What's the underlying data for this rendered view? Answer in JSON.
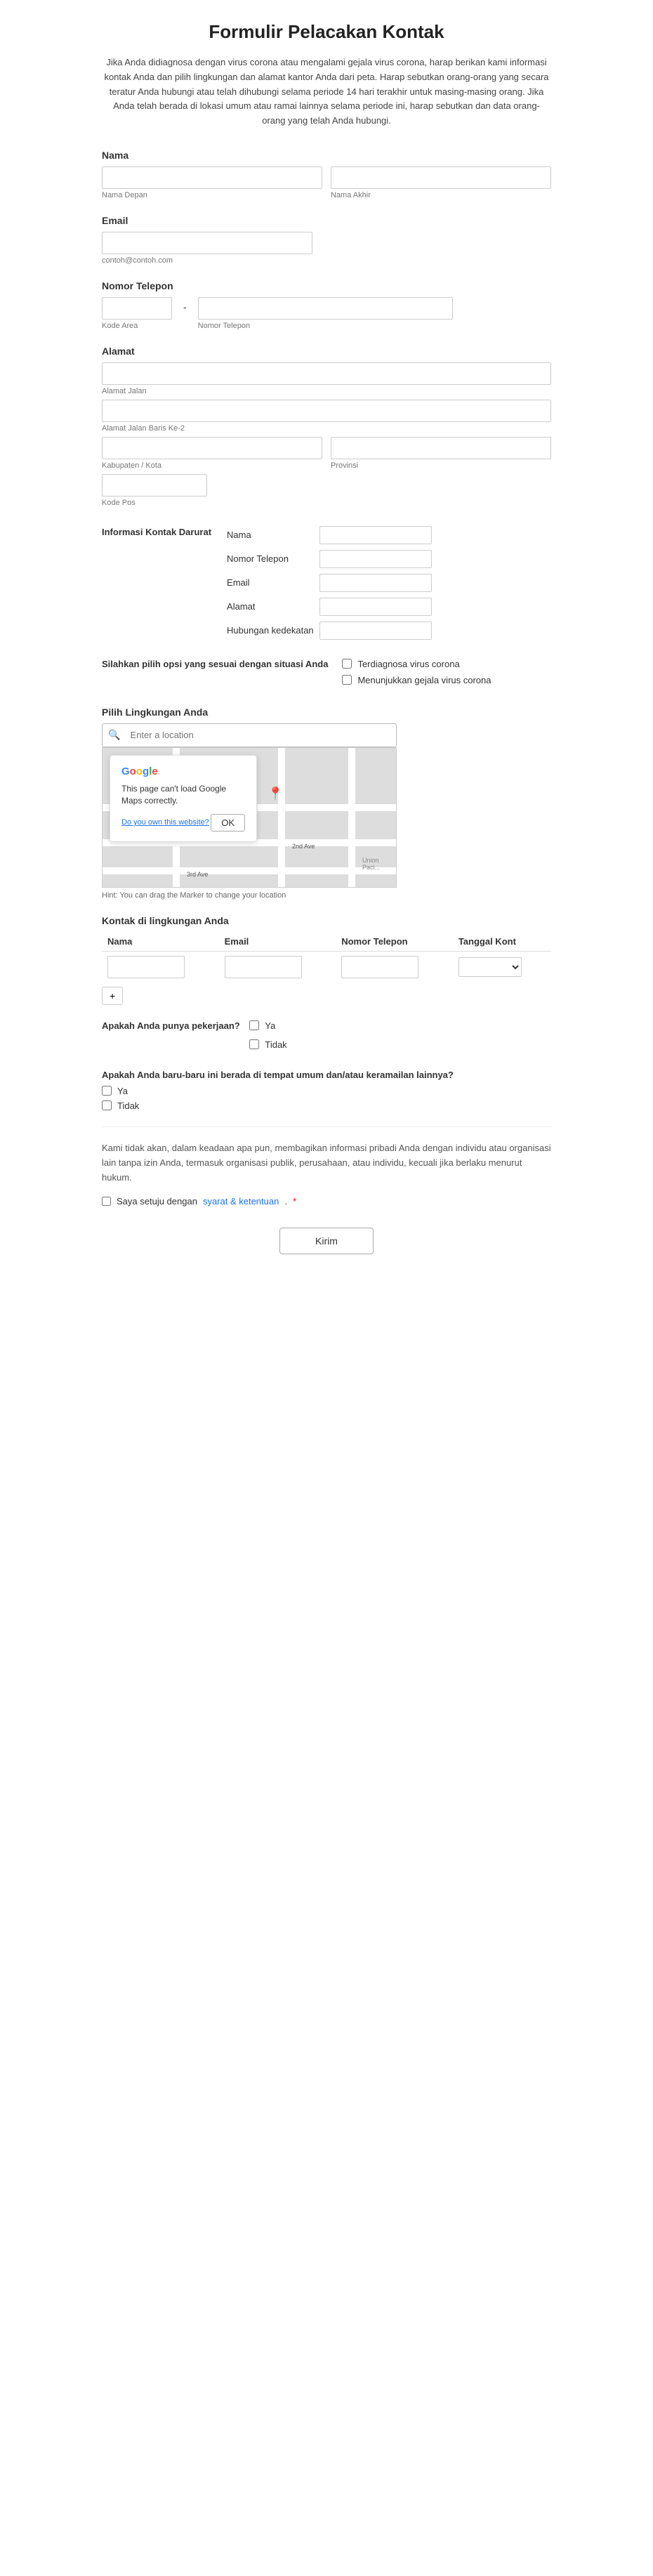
{
  "page": {
    "title": "Formulir Pelacakan Kontak",
    "intro": "Jika Anda didiagnosa dengan virus corona atau mengalami gejala virus corona, harap berikan kami informasi kontak Anda dan pilih lingkungan dan alamat kantor Anda dari peta. Harap sebutkan orang-orang yang secara teratur Anda hubungi atau telah dihubungi selama periode 14 hari terakhir untuk masing-masing orang. Jika Anda telah berada di lokasi umum atau ramai lainnya selama periode ini, harap sebutkan dan data orang-orang yang telah Anda hubungi."
  },
  "form": {
    "nama_section_label": "Nama",
    "nama_depan_placeholder": "Nama Depan",
    "nama_akhir_placeholder": "Nama Akhir",
    "nama_depan_hint": "Nama Depan",
    "nama_akhir_hint": "Nama Akhir",
    "email_section_label": "Email",
    "email_placeholder": "",
    "email_hint": "contoh@contoh.com",
    "phone_section_label": "Nomor Telepon",
    "phone_area_hint": "Kode Area",
    "phone_number_hint": "Nomor Telepon",
    "alamat_section_label": "Alamat",
    "alamat_jalan_hint": "Alamat Jalan",
    "alamat_jalan2_hint": "Alamat Jalan Baris Ke-2",
    "kabupaten_hint": "Kabupaten / Kota",
    "provinsi_hint": "Provinsi",
    "kode_pos_hint": "Kode Pos",
    "emergency_section_label": "Informasi Kontak Darurat",
    "emergency_fields": [
      {
        "label": "Nama",
        "value": ""
      },
      {
        "label": "Nomor Telepon",
        "value": ""
      },
      {
        "label": "Email",
        "value": ""
      },
      {
        "label": "Alamat",
        "value": ""
      },
      {
        "label": "Hubungan kedekatan",
        "value": ""
      }
    ],
    "situation_label": "Silahkan pilih opsi yang sesuai dengan situasi Anda",
    "situation_options": [
      {
        "label": "Terdiagnosa virus corona"
      },
      {
        "label": "Menunjukkan gejala virus corona"
      }
    ],
    "env_section_label": "Pilih Lingkungan Anda",
    "env_search_placeholder": "Enter a location",
    "map_error_title": "Google",
    "map_error_message": "This page can't load Google Maps correctly.",
    "map_error_link": "Do you own this website?",
    "map_ok_button": "OK",
    "map_hint": "Hint: You can drag the Marker to change your location",
    "env_contacts_label": "Kontak di lingkungan Anda",
    "env_contacts_columns": [
      "Nama",
      "Email",
      "Nomor Telepon",
      "Tanggal Kont"
    ],
    "add_row_label": "+",
    "job_question": "Apakah Anda punya pekerjaan?",
    "job_options": [
      {
        "label": "Ya"
      },
      {
        "label": "Tidak"
      }
    ],
    "public_question": "Apakah Anda baru-baru ini berada di tempat umum dan/atau keramailan lainnya?",
    "public_options": [
      {
        "label": "Ya"
      },
      {
        "label": "Tidak"
      }
    ],
    "privacy_text": "Kami tidak akan, dalam keadaan apa pun, membagikan informasi pribadi Anda dengan individu atau organisasi lain tanpa izin Anda, termasuk organisasi publik, perusahaan, atau individu, kecuali jika berlaku menurut hukum.",
    "agree_prefix": "Saya setuju dengan",
    "agree_link": "syarat & ketentuan",
    "agree_suffix": ".",
    "required_marker": "*",
    "submit_label": "Kirim"
  }
}
